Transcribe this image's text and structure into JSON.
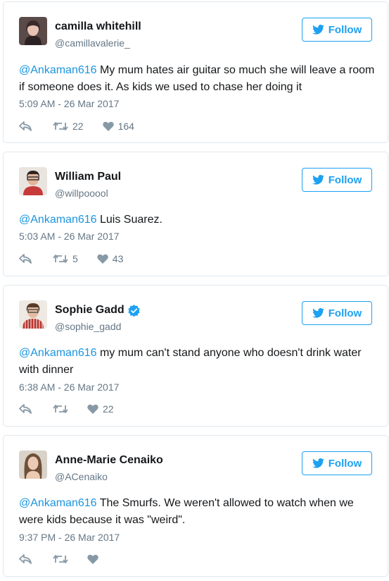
{
  "follow_label": "Follow",
  "colors": {
    "link": "#1b95e0",
    "follow": "#1da1f2",
    "verified": "#1da1f2",
    "secondary": "#657786"
  },
  "tweets": [
    {
      "name": "camilla whitehill",
      "handle": "@camillavalerie_",
      "verified": false,
      "mention": "@Ankaman616",
      "text": " My mum hates air guitar so much she will leave a room if someone does it. As kids we used to chase her doing it",
      "time": "5:09 AM - 26 Mar 2017",
      "retweets": "22",
      "likes": "164"
    },
    {
      "name": "William Paul",
      "handle": "@willpooool",
      "verified": false,
      "mention": "@Ankaman616",
      "text": " Luis Suarez.",
      "time": "5:03 AM - 26 Mar 2017",
      "retweets": "5",
      "likes": "43"
    },
    {
      "name": "Sophie Gadd",
      "handle": "@sophie_gadd",
      "verified": true,
      "mention": "@Ankaman616",
      "text": " my mum can't stand anyone who doesn't drink water with dinner",
      "time": "6:38 AM - 26 Mar 2017",
      "retweets": "",
      "likes": "22"
    },
    {
      "name": "Anne-Marie Cenaiko",
      "handle": "@ACenaiko",
      "verified": false,
      "mention": "@Ankaman616",
      "text": " The Smurfs. We weren't allowed to watch when we were kids because it was \"weird\".",
      "time": "9:37 PM - 26 Mar 2017",
      "retweets": "",
      "likes": ""
    }
  ]
}
